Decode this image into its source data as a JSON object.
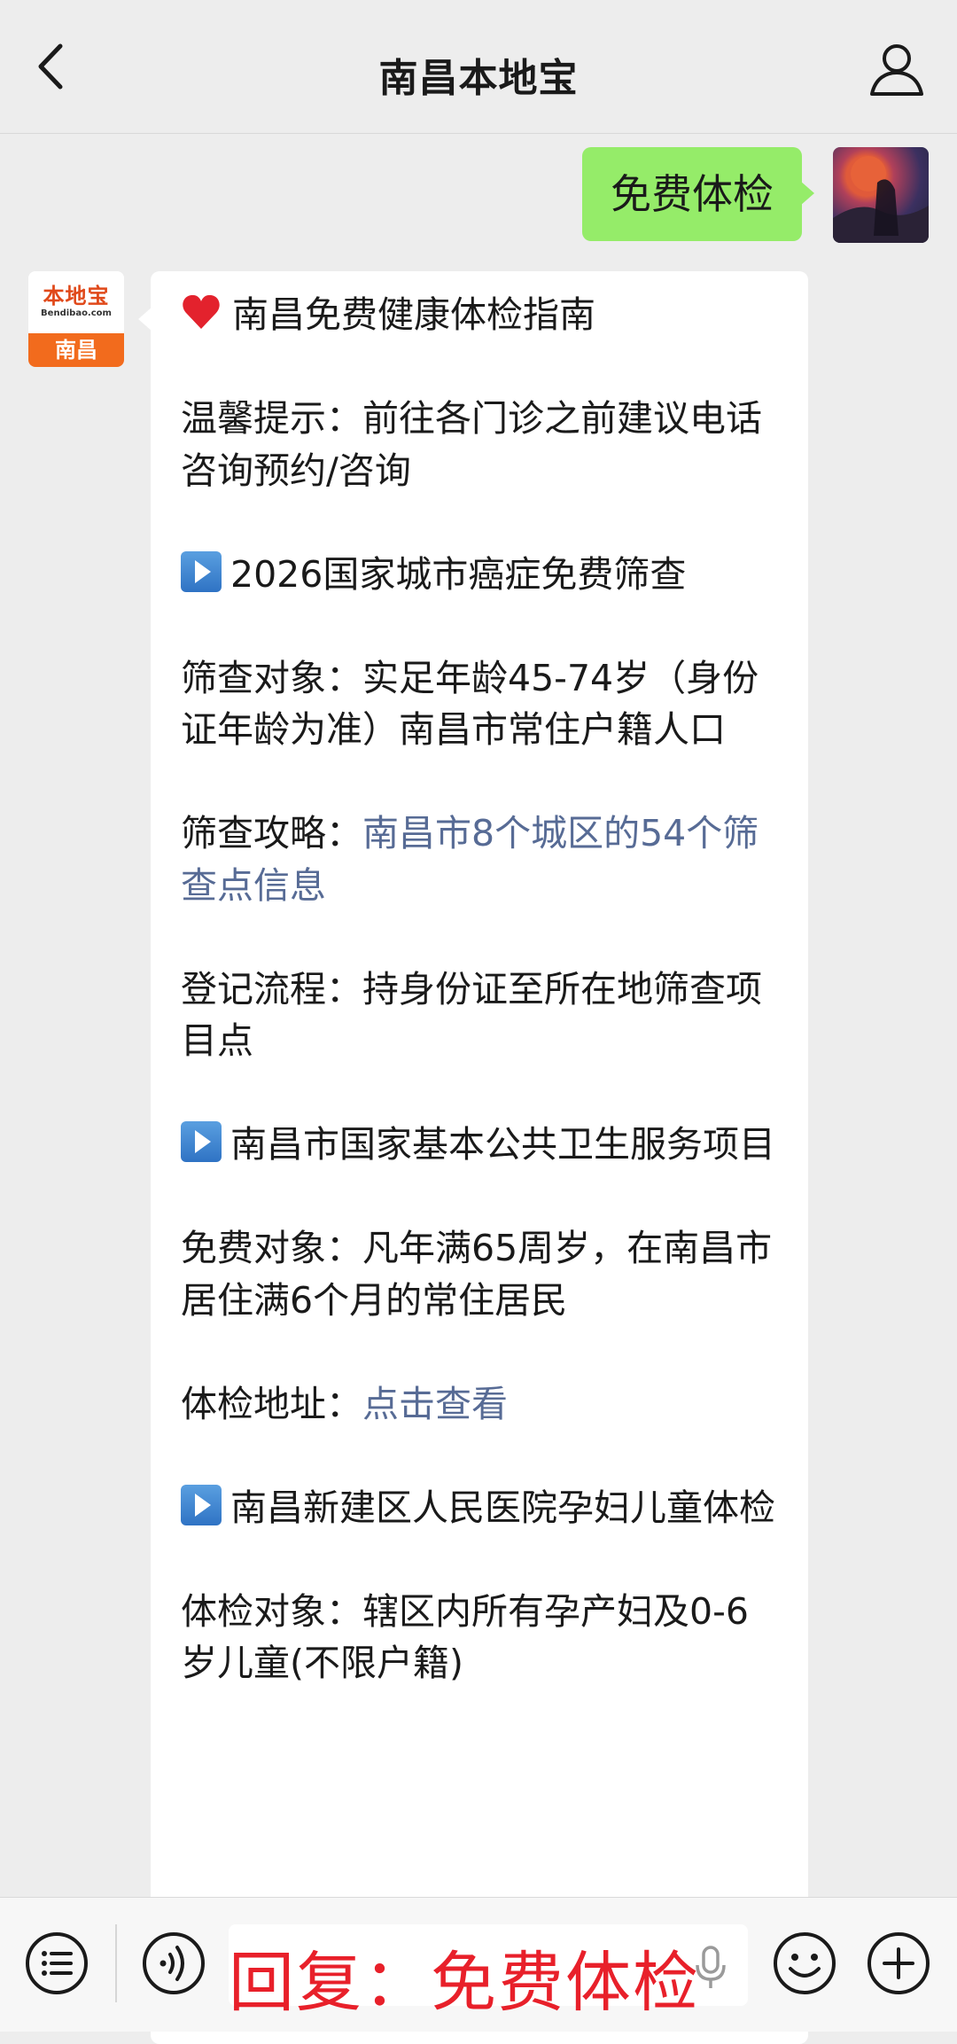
{
  "header": {
    "title": "南昌本地宝"
  },
  "self_message": {
    "text": "免费体检"
  },
  "bot": {
    "logo_text": "本地宝",
    "logo_sub": "Bendibao.com",
    "city": "南昌"
  },
  "reply": {
    "heading": "南昌免费健康体检指南",
    "tip": "温馨提示：前往各门诊之前建议电话咨询预约/咨询",
    "s1_title": "2026国家城市癌症免费筛查",
    "s1_target": "筛查对象：实足年龄45-74岁（身份证年龄为准）南昌市常住户籍人口",
    "s1_guide_label": "筛查攻略：",
    "s1_guide_link": "南昌市8个城区的54个筛查点信息",
    "s1_process": "登记流程：持身份证至所在地筛查项目点",
    "s2_title": "南昌市国家基本公共卫生服务项目",
    "s2_target": "免费对象：凡年满65周岁，在南昌市居住满6个月的常住居民",
    "s2_addr_label": "体检地址：",
    "s2_addr_link": "点击查看",
    "s3_title": "南昌新建区人民医院孕妇儿童体检",
    "s3_target": "体检对象：辖区内所有孕产妇及0-6岁儿童(不限户籍)"
  },
  "input": {
    "value": "回复：免费体检"
  },
  "icons": {
    "back": "chevron-left-icon",
    "profile": "person-icon",
    "menu": "list-icon",
    "voice": "voice-icon",
    "mic": "mic-icon",
    "emoji": "smile-icon",
    "plus": "plus-icon",
    "heart": "heart-icon",
    "play": "play-icon"
  },
  "colors": {
    "self_bubble": "#95ec69",
    "link": "#576b95",
    "input_text": "#e8202a",
    "bot_brand": "#f26b1d"
  }
}
